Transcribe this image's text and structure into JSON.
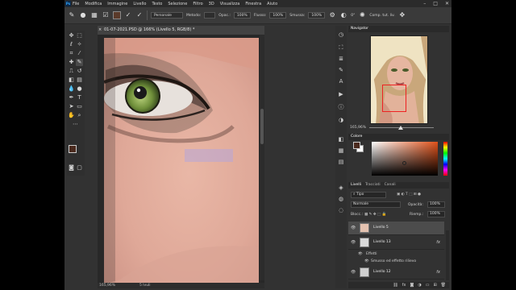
{
  "menu": [
    "File",
    "Modifica",
    "Immagine",
    "Livello",
    "Testo",
    "Selezione",
    "Filtro",
    "3D",
    "Visualizza",
    "Finestra",
    "Aiuto"
  ],
  "ps_logo": "Ps",
  "options": {
    "brush_size": "",
    "mode_label": "",
    "mode_value": "Personale",
    "blend_label": "Metodo:",
    "opacity_label": "Opac.:",
    "opacity_value": "100%",
    "flow_label": "Flusso:",
    "flow_value": "100%",
    "smooth_label": "Smussa:",
    "smooth_value": "100%",
    "angle_value": "0°",
    "sample_label": "Comp. tut. liv."
  },
  "document": {
    "tab_title": "01-07-2021.PSD @ 166% (Livello 5, RGB/8) *",
    "zoom": "165,96%",
    "status_extra": "5 lvuli"
  },
  "navigator": {
    "tab": "Navigator",
    "zoom": "165,96%"
  },
  "color": {
    "tab": "Colore",
    "fg": "#4a2a1e",
    "bg": "#ffffff"
  },
  "layers": {
    "tabs": [
      "Livelli",
      "Tracciati",
      "Canali"
    ],
    "filter_label": "Tipo",
    "blend": "Normale",
    "opacity_label": "Opacità:",
    "opacity": "100%",
    "lock_label": "Blocc.:",
    "fill_label": "Riemp.:",
    "fill": "100%",
    "items": [
      {
        "name": "Livello 5",
        "selected": true,
        "fx": ""
      },
      {
        "name": "Livello 13",
        "selected": false,
        "fx": "fx"
      },
      {
        "name": "Livello 12",
        "selected": false,
        "fx": "fx"
      }
    ],
    "effects_label": "Effetti",
    "effect_item": "Smusso ed effetto rilievo"
  }
}
